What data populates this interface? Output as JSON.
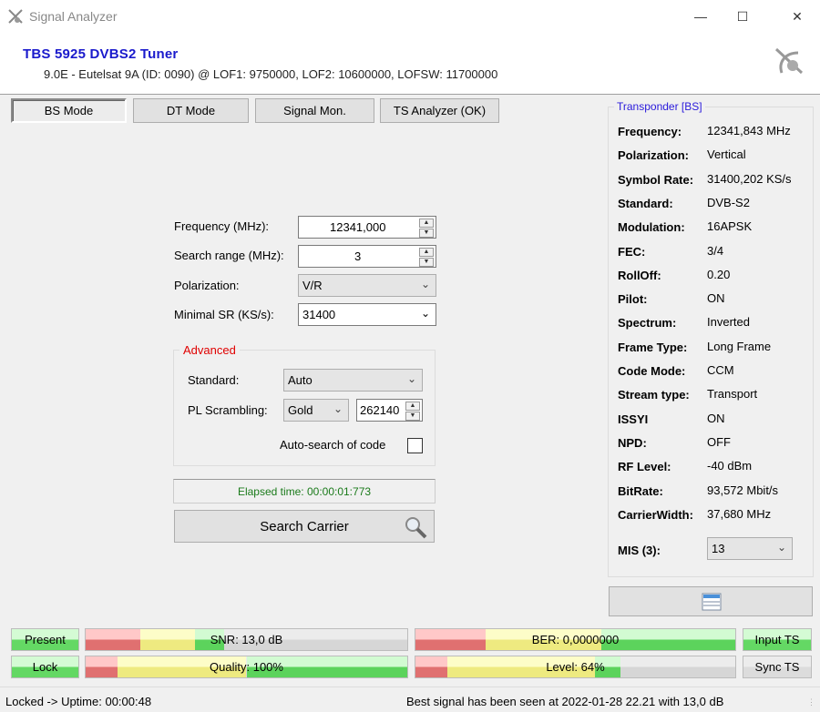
{
  "window": {
    "title": "Signal Analyzer"
  },
  "header": {
    "tuner": "TBS 5925 DVBS2 Tuner",
    "satellite": "9.0E - Eutelsat 9A (ID: 0090) @ LOF1: 9750000, LOF2: 10600000, LOFSW: 11700000"
  },
  "tabs": [
    {
      "label": "BS Mode"
    },
    {
      "label": "DT Mode"
    },
    {
      "label": "Signal Mon."
    },
    {
      "label": "TS Analyzer (OK)"
    }
  ],
  "form": {
    "frequency_label": "Frequency (MHz):",
    "frequency_value": "12341,000",
    "range_label": "Search range (MHz):",
    "range_value": "3",
    "polarization_label": "Polarization:",
    "polarization_value": "V/R",
    "minsr_label": "Minimal SR (KS/s):",
    "minsr_value": "31400",
    "advanced_title": "Advanced",
    "standard_label": "Standard:",
    "standard_value": "Auto",
    "pls_label": "PL Scrambling:",
    "pls_mode": "Gold",
    "pls_value": "262140",
    "autosearch_label": "Auto-search of code",
    "autosearch_checked": false,
    "elapsed": "Elapsed time: 00:00:01:773",
    "search_button": "Search Carrier"
  },
  "transponder": {
    "title": "Transponder [BS]",
    "rows": [
      {
        "label": "Frequency:",
        "value": "12341,843 MHz"
      },
      {
        "label": "Polarization:",
        "value": "Vertical"
      },
      {
        "label": "Symbol Rate:",
        "value": "31400,202 KS/s"
      },
      {
        "label": "Standard:",
        "value": "DVB-S2"
      },
      {
        "label": "Modulation:",
        "value": "16APSK"
      },
      {
        "label": "FEC:",
        "value": "3/4"
      },
      {
        "label": "RollOff:",
        "value": "0.20"
      },
      {
        "label": "Pilot:",
        "value": "ON"
      },
      {
        "label": "Spectrum:",
        "value": "Inverted"
      },
      {
        "label": "Frame Type:",
        "value": "Long Frame"
      },
      {
        "label": "Code Mode:",
        "value": "CCM"
      },
      {
        "label": "Stream type:",
        "value": "Transport"
      },
      {
        "label": "ISSYI",
        "value": "ON"
      },
      {
        "label": "NPD:",
        "value": "OFF"
      },
      {
        "label": "RF Level:",
        "value": "-40 dBm"
      },
      {
        "label": "BitRate:",
        "value": "93,572 Mbit/s"
      },
      {
        "label": "CarrierWidth:",
        "value": "37,680 MHz"
      }
    ],
    "mis_label": "MIS (3):",
    "mis_value": "13"
  },
  "indicators": {
    "present": "Present",
    "lock": "Lock",
    "input_ts": "Input TS",
    "sync_ts": "Sync TS"
  },
  "bars": {
    "snr": {
      "label": "SNR: 13,0 dB",
      "fill_percent": 43
    },
    "ber": {
      "label": "BER: 0,0000000",
      "fill_percent": 100
    },
    "quality": {
      "label": "Quality: 100%",
      "fill_percent": 100
    },
    "level": {
      "label": "Level: 64%",
      "fill_percent": 64
    }
  },
  "status": {
    "left": "Locked -> Uptime: 00:00:48",
    "right": "Best signal has been seen at 2022-01-28 22.21 with 13,0 dB"
  }
}
